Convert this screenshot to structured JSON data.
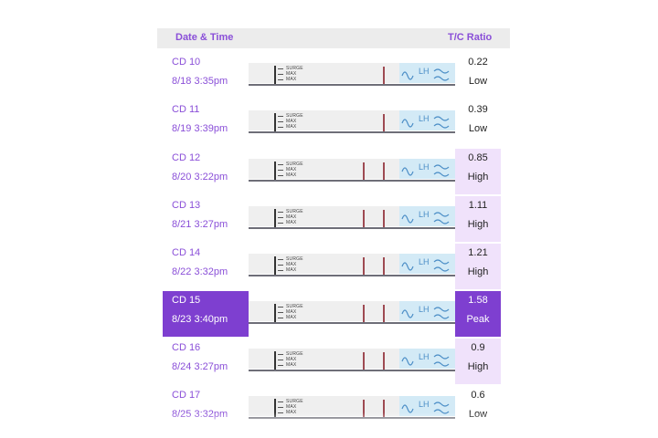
{
  "header": {
    "date_label": "Date & Time",
    "ratio_label": "T/C Ratio"
  },
  "strip": {
    "mark1": "SURGE",
    "mark2": "MAX",
    "mark3": "MAX",
    "lh_label": "LH",
    "icon": "wave-icon"
  },
  "colors": {
    "accent": "#8a4fd8",
    "peak_fill": "#7e3fd0",
    "high_fill": "#f0e2fb",
    "test_line": "#9e4a52",
    "wand": "#d3eaf6"
  },
  "rows": [
    {
      "cd": "CD 10",
      "datetime": "8/18  3:35pm",
      "ratio": "0.22",
      "level": "Low"
    },
    {
      "cd": "CD 11",
      "datetime": "8/19  3:39pm",
      "ratio": "0.39",
      "level": "Low"
    },
    {
      "cd": "CD 12",
      "datetime": "8/20  3:22pm",
      "ratio": "0.85",
      "level": "High"
    },
    {
      "cd": "CD 13",
      "datetime": "8/21  3:27pm",
      "ratio": "1.11",
      "level": "High"
    },
    {
      "cd": "CD 14",
      "datetime": "8/22  3:32pm",
      "ratio": "1.21",
      "level": "High"
    },
    {
      "cd": "CD 15",
      "datetime": "8/23  3:40pm",
      "ratio": "1.58",
      "level": "Peak"
    },
    {
      "cd": "CD 16",
      "datetime": "8/24  3:27pm",
      "ratio": "0.9",
      "level": "High"
    },
    {
      "cd": "CD 17",
      "datetime": "8/25  3:32pm",
      "ratio": "0.6",
      "level": "Low"
    }
  ]
}
